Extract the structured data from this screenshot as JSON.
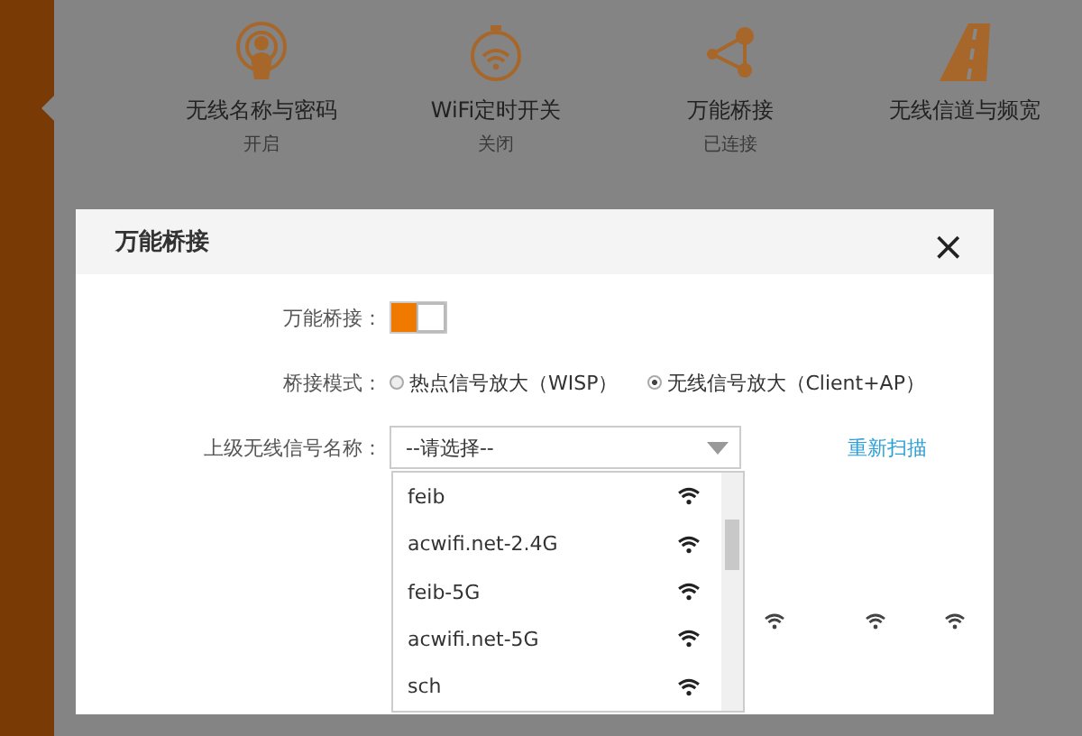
{
  "features": [
    {
      "kind": "broadcast",
      "title": "无线名称与密码",
      "status": "开启"
    },
    {
      "kind": "timer",
      "title": "WiFi定时开关",
      "status": "关闭"
    },
    {
      "kind": "bridge",
      "title": "万能桥接",
      "status": "已连接"
    },
    {
      "kind": "road",
      "title": "无线信道与频宽"
    }
  ],
  "dialog": {
    "title": "万能桥接",
    "close": "×",
    "toggle": {
      "label": "万能桥接：",
      "on": true
    },
    "mode": {
      "label": "桥接模式：",
      "options": [
        {
          "label": "热点信号放大（WISP）",
          "selected": false
        },
        {
          "label": "无线信号放大（Client+AP）",
          "selected": true
        }
      ]
    },
    "upstream": {
      "label": "上级无线信号名称：",
      "placeholder": "--请选择--",
      "rescan": "重新扫描",
      "networks": [
        {
          "name": "feib"
        },
        {
          "name": "acwifi.net-2.4G"
        },
        {
          "name": "feib-5G"
        },
        {
          "name": "acwifi.net-5G"
        },
        {
          "name": "sch"
        }
      ]
    }
  }
}
